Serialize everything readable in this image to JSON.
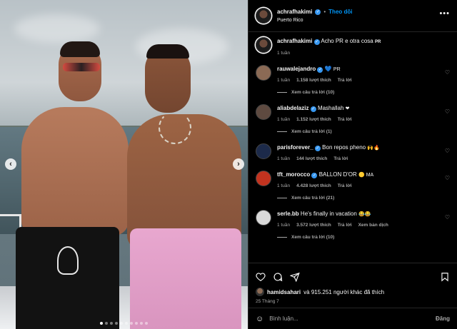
{
  "post": {
    "author": "achrafhakimi",
    "follow_label": "Theo dõi",
    "separator": "•",
    "location": "Puerto Rico",
    "caption_text": "Acho PR e otra cosa",
    "caption_tag": "PR",
    "caption_time": "1 tuần"
  },
  "carousel": {
    "prev": "‹",
    "next": "›",
    "dot_count": 10,
    "active_dot_index": 0
  },
  "comments": [
    {
      "user": "rauwalejandro",
      "verified": true,
      "text": "💙",
      "tail": "PR",
      "time": "1 tuần",
      "likes": "1.158 lượt thích",
      "reply": "Trả lời",
      "translate": "",
      "view_replies": "Xem câu trả lời (10)",
      "avatar_color": "#8b6a55"
    },
    {
      "user": "aliabdelaziz",
      "verified": true,
      "text": "Mashallah",
      "tail": "❤",
      "time": "1 tuần",
      "likes": "1.152 lượt thích",
      "reply": "Trả lời",
      "translate": "",
      "view_replies": "Xem câu trả lời (1)",
      "avatar_color": "#5e4a40"
    },
    {
      "user": "parisforever_",
      "verified": true,
      "text": "Bon repos pheno",
      "tail": "🙌🔥",
      "time": "1 tuần",
      "likes": "144 lượt thích",
      "reply": "Trả lời",
      "translate": "",
      "view_replies": "",
      "avatar_color": "#1c2a4a"
    },
    {
      "user": "tft_morocco",
      "verified": true,
      "text": "BALLON D'OR",
      "tail": "🟡 MA",
      "time": "1 tuần",
      "likes": "4.428 lượt thích",
      "reply": "Trả lời",
      "translate": "",
      "view_replies": "Xem câu trả lời (21)",
      "avatar_color": "#c2331f"
    },
    {
      "user": "serle.bb",
      "verified": false,
      "text": "He's finally in vacation",
      "tail": "😂😂",
      "time": "1 tuần",
      "likes": "3.572 lượt thích",
      "reply": "Trả lời",
      "translate": "Xem bản dịch",
      "view_replies": "Xem câu trả lời (10)",
      "avatar_color": "#d9d9d9"
    }
  ],
  "footer": {
    "liker": "hamidsahari",
    "likes_rest": "và 915.251 người khác đã thích",
    "date": "25 Tháng 7",
    "comment_placeholder": "Bình luận...",
    "post_label": "Đăng"
  },
  "colors": {
    "accent": "#0095f6",
    "verified": "#3797f0",
    "muted": "#a8a8a8",
    "heart_red": "#ed4956"
  },
  "icons": {
    "like": "heart-icon",
    "comment": "comment-icon",
    "share": "share-icon",
    "save": "bookmark-icon",
    "more": "more-options-icon",
    "emoji": "emoji-icon"
  }
}
